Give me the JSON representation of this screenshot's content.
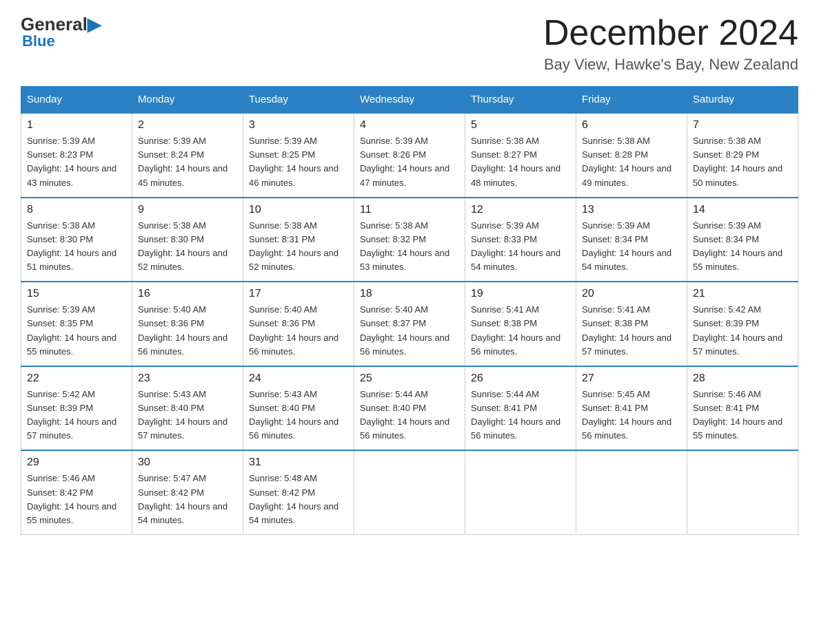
{
  "header": {
    "logo": {
      "general": "General",
      "blue": "Blue",
      "triangle": "▶"
    },
    "title": "December 2024",
    "location": "Bay View, Hawke's Bay, New Zealand"
  },
  "calendar": {
    "days_of_week": [
      "Sunday",
      "Monday",
      "Tuesday",
      "Wednesday",
      "Thursday",
      "Friday",
      "Saturday"
    ],
    "weeks": [
      [
        {
          "day": "1",
          "sunrise": "5:39 AM",
          "sunset": "8:23 PM",
          "daylight": "14 hours and 43 minutes."
        },
        {
          "day": "2",
          "sunrise": "5:39 AM",
          "sunset": "8:24 PM",
          "daylight": "14 hours and 45 minutes."
        },
        {
          "day": "3",
          "sunrise": "5:39 AM",
          "sunset": "8:25 PM",
          "daylight": "14 hours and 46 minutes."
        },
        {
          "day": "4",
          "sunrise": "5:39 AM",
          "sunset": "8:26 PM",
          "daylight": "14 hours and 47 minutes."
        },
        {
          "day": "5",
          "sunrise": "5:38 AM",
          "sunset": "8:27 PM",
          "daylight": "14 hours and 48 minutes."
        },
        {
          "day": "6",
          "sunrise": "5:38 AM",
          "sunset": "8:28 PM",
          "daylight": "14 hours and 49 minutes."
        },
        {
          "day": "7",
          "sunrise": "5:38 AM",
          "sunset": "8:29 PM",
          "daylight": "14 hours and 50 minutes."
        }
      ],
      [
        {
          "day": "8",
          "sunrise": "5:38 AM",
          "sunset": "8:30 PM",
          "daylight": "14 hours and 51 minutes."
        },
        {
          "day": "9",
          "sunrise": "5:38 AM",
          "sunset": "8:30 PM",
          "daylight": "14 hours and 52 minutes."
        },
        {
          "day": "10",
          "sunrise": "5:38 AM",
          "sunset": "8:31 PM",
          "daylight": "14 hours and 52 minutes."
        },
        {
          "day": "11",
          "sunrise": "5:38 AM",
          "sunset": "8:32 PM",
          "daylight": "14 hours and 53 minutes."
        },
        {
          "day": "12",
          "sunrise": "5:39 AM",
          "sunset": "8:33 PM",
          "daylight": "14 hours and 54 minutes."
        },
        {
          "day": "13",
          "sunrise": "5:39 AM",
          "sunset": "8:34 PM",
          "daylight": "14 hours and 54 minutes."
        },
        {
          "day": "14",
          "sunrise": "5:39 AM",
          "sunset": "8:34 PM",
          "daylight": "14 hours and 55 minutes."
        }
      ],
      [
        {
          "day": "15",
          "sunrise": "5:39 AM",
          "sunset": "8:35 PM",
          "daylight": "14 hours and 55 minutes."
        },
        {
          "day": "16",
          "sunrise": "5:40 AM",
          "sunset": "8:36 PM",
          "daylight": "14 hours and 56 minutes."
        },
        {
          "day": "17",
          "sunrise": "5:40 AM",
          "sunset": "8:36 PM",
          "daylight": "14 hours and 56 minutes."
        },
        {
          "day": "18",
          "sunrise": "5:40 AM",
          "sunset": "8:37 PM",
          "daylight": "14 hours and 56 minutes."
        },
        {
          "day": "19",
          "sunrise": "5:41 AM",
          "sunset": "8:38 PM",
          "daylight": "14 hours and 56 minutes."
        },
        {
          "day": "20",
          "sunrise": "5:41 AM",
          "sunset": "8:38 PM",
          "daylight": "14 hours and 57 minutes."
        },
        {
          "day": "21",
          "sunrise": "5:42 AM",
          "sunset": "8:39 PM",
          "daylight": "14 hours and 57 minutes."
        }
      ],
      [
        {
          "day": "22",
          "sunrise": "5:42 AM",
          "sunset": "8:39 PM",
          "daylight": "14 hours and 57 minutes."
        },
        {
          "day": "23",
          "sunrise": "5:43 AM",
          "sunset": "8:40 PM",
          "daylight": "14 hours and 57 minutes."
        },
        {
          "day": "24",
          "sunrise": "5:43 AM",
          "sunset": "8:40 PM",
          "daylight": "14 hours and 56 minutes."
        },
        {
          "day": "25",
          "sunrise": "5:44 AM",
          "sunset": "8:40 PM",
          "daylight": "14 hours and 56 minutes."
        },
        {
          "day": "26",
          "sunrise": "5:44 AM",
          "sunset": "8:41 PM",
          "daylight": "14 hours and 56 minutes."
        },
        {
          "day": "27",
          "sunrise": "5:45 AM",
          "sunset": "8:41 PM",
          "daylight": "14 hours and 56 minutes."
        },
        {
          "day": "28",
          "sunrise": "5:46 AM",
          "sunset": "8:41 PM",
          "daylight": "14 hours and 55 minutes."
        }
      ],
      [
        {
          "day": "29",
          "sunrise": "5:46 AM",
          "sunset": "8:42 PM",
          "daylight": "14 hours and 55 minutes."
        },
        {
          "day": "30",
          "sunrise": "5:47 AM",
          "sunset": "8:42 PM",
          "daylight": "14 hours and 54 minutes."
        },
        {
          "day": "31",
          "sunrise": "5:48 AM",
          "sunset": "8:42 PM",
          "daylight": "14 hours and 54 minutes."
        },
        null,
        null,
        null,
        null
      ]
    ]
  }
}
